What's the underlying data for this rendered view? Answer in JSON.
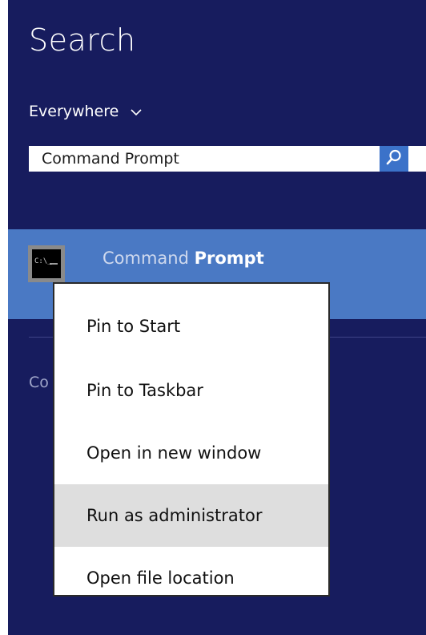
{
  "search": {
    "title": "Search",
    "scope_label": "Everywhere",
    "query": "Command Prompt"
  },
  "result": {
    "name_dim": "Command ",
    "name_bold": "Prompt",
    "icon_text": "C:\\_"
  },
  "section": {
    "label_visible": "Co"
  },
  "context_menu": {
    "items": [
      {
        "label": "Pin to Start"
      },
      {
        "label": "Pin to Taskbar"
      },
      {
        "label": "Open in new window"
      },
      {
        "label": "Run as administrator",
        "highlighted": true
      },
      {
        "label": "Open file location"
      }
    ]
  },
  "colors": {
    "pane_bg": "#171c5e",
    "result_bg": "#4a79c4",
    "search_button_bg": "#3b72c9",
    "menu_highlight": "#dedede"
  }
}
